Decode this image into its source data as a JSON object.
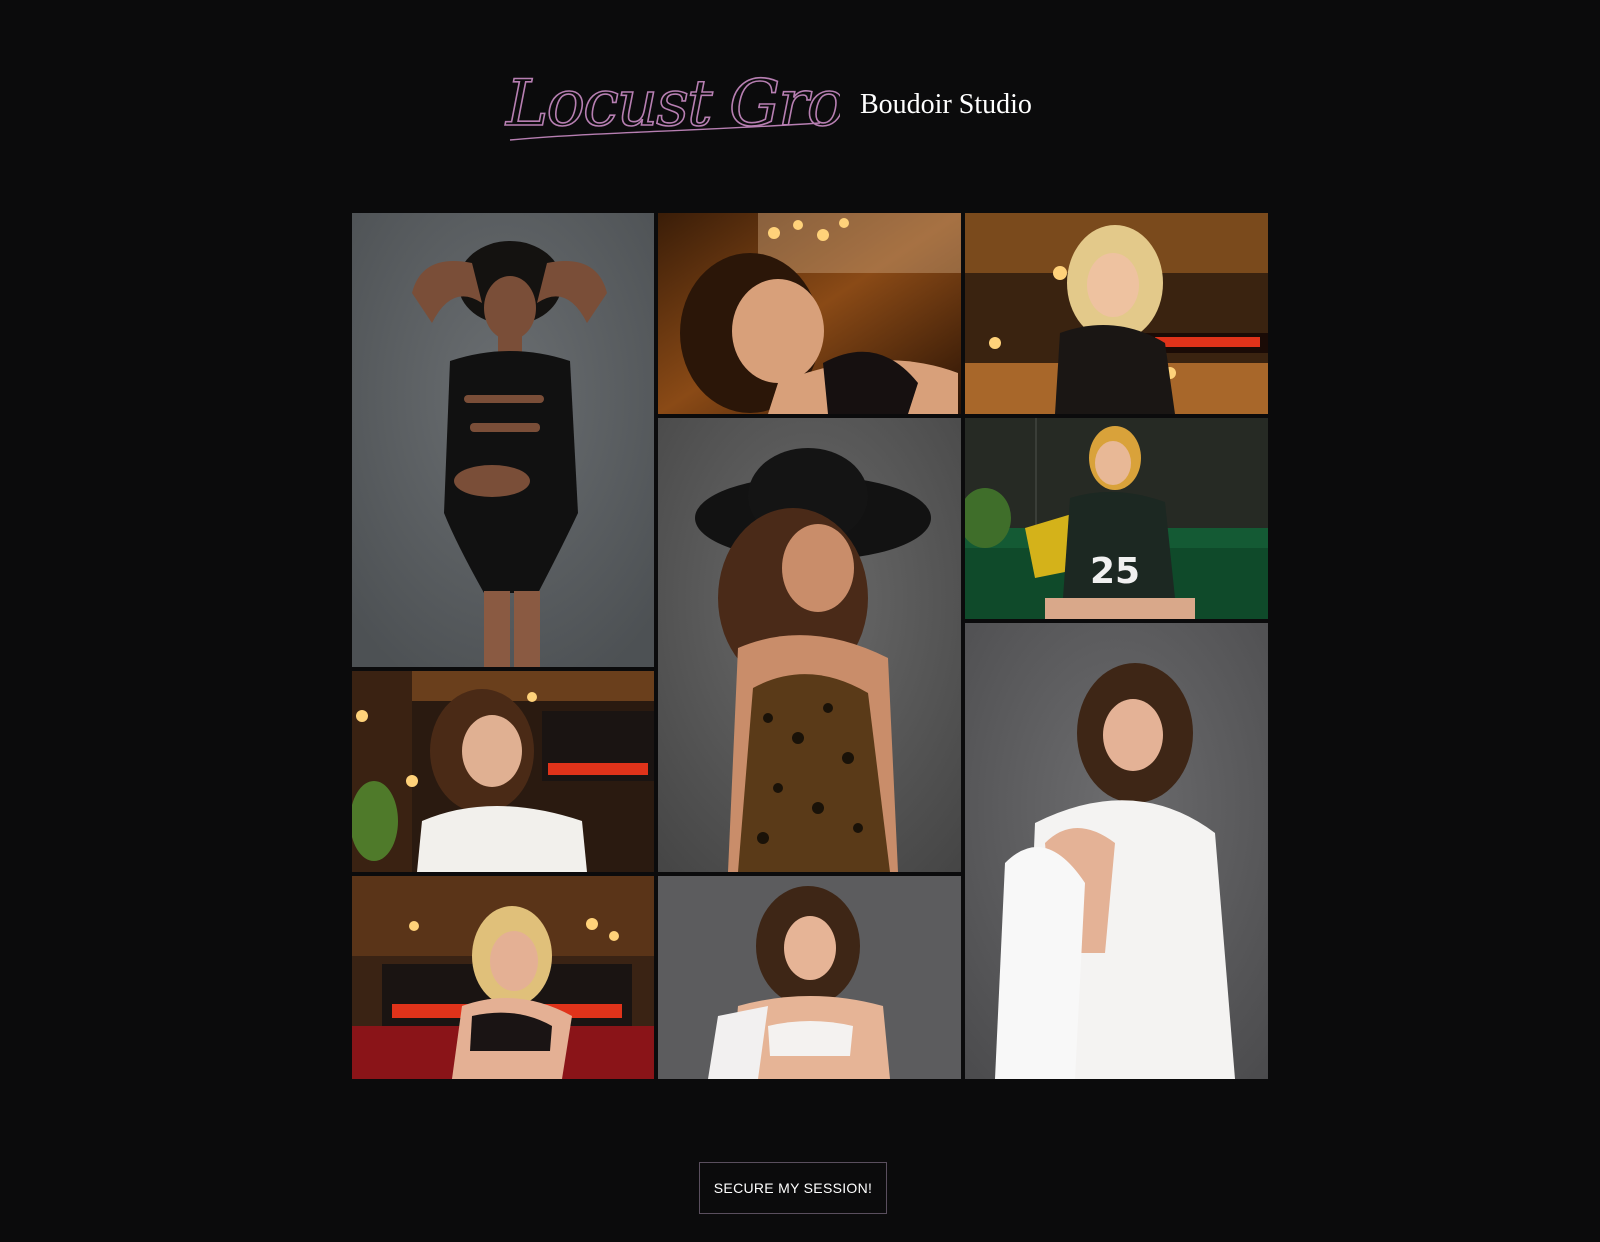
{
  "brand": {
    "script_name": "Locust Grove",
    "subtitle": "Boudoir Studio",
    "accent_color": "#b77fb2"
  },
  "gallery": {
    "photos": [
      {
        "id": "photo-1",
        "subject": "woman-black-cutout-bodysuit-grey-backdrop"
      },
      {
        "id": "photo-2",
        "subject": "woman-black-lace-candles"
      },
      {
        "id": "photo-3",
        "subject": "blonde-woman-black-satin-fireplace"
      },
      {
        "id": "photo-4",
        "subject": "woman-white-top-fireplace"
      },
      {
        "id": "photo-5",
        "subject": "woman-black-hat-leopard-bodysuit"
      },
      {
        "id": "photo-6",
        "subject": "woman-football-jersey-green-sofa"
      },
      {
        "id": "photo-7",
        "subject": "blonde-woman-black-lingerie-red-sofa"
      },
      {
        "id": "photo-8",
        "subject": "woman-white-lace-lingerie-smiling"
      },
      {
        "id": "photo-9",
        "subject": "woman-white-robe-seated"
      }
    ]
  },
  "cta": {
    "label": "SECURE MY SESSION!"
  }
}
